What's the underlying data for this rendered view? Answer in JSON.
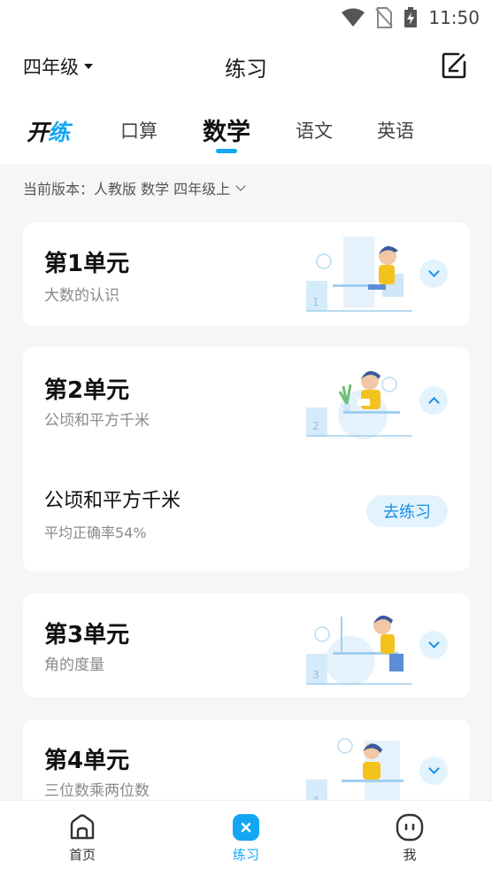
{
  "status": {
    "time": "11:50"
  },
  "header": {
    "grade_label": "四年级",
    "title": "练习"
  },
  "tabs": {
    "logo_a": "开",
    "logo_b": "练",
    "items": [
      {
        "label": "口算",
        "active": false
      },
      {
        "label": "数学",
        "active": true
      },
      {
        "label": "语文",
        "active": false
      },
      {
        "label": "英语",
        "active": false
      }
    ]
  },
  "version": {
    "text": "当前版本：人教版 数学 四年级上"
  },
  "units": [
    {
      "title": "第1单元",
      "subtitle": "大数的认识",
      "expanded": false,
      "illus_number": "1"
    },
    {
      "title": "第2单元",
      "subtitle": "公顷和平方千米",
      "expanded": true,
      "illus_number": "2",
      "lessons": [
        {
          "title": "公顷和平方千米",
          "rate": "平均正确率54%",
          "button": "去练习"
        }
      ]
    },
    {
      "title": "第3单元",
      "subtitle": "角的度量",
      "expanded": false,
      "illus_number": "3"
    },
    {
      "title": "第4单元",
      "subtitle": "三位数乘两位数",
      "expanded": false,
      "illus_number": "4"
    }
  ],
  "nav": {
    "items": [
      {
        "label": "首页",
        "icon": "home-icon",
        "active": false
      },
      {
        "label": "练习",
        "icon": "practice-icon",
        "active": true
      },
      {
        "label": "我",
        "icon": "profile-icon",
        "active": false
      }
    ]
  },
  "colors": {
    "accent": "#13a6f5",
    "accent_light": "#e3f3fd",
    "button_text": "#1590e6"
  }
}
